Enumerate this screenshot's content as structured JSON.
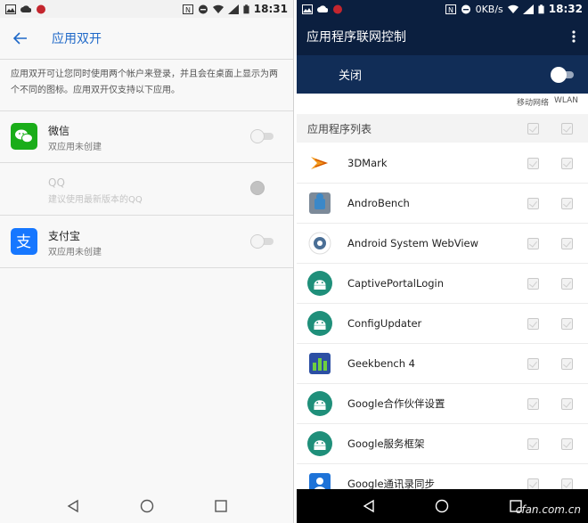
{
  "left": {
    "statusbar": {
      "time": "18:31"
    },
    "header": {
      "title": "应用双开"
    },
    "description": "应用双开可让您同时使用两个帐户来登录，并且会在桌面上显示为两个不同的图标。应用双开仅支持以下应用。",
    "apps": [
      {
        "name": "微信",
        "subtitle": "双应用未创建",
        "enabled": true,
        "icon": "wechat-icon",
        "color": "#1aad19"
      },
      {
        "name": "QQ",
        "subtitle": "建议使用最新版本的QQ",
        "enabled": false,
        "icon": "qq-icon"
      },
      {
        "name": "支付宝",
        "subtitle": "双应用未创建",
        "enabled": true,
        "icon": "alipay-icon",
        "color": "#1677ff"
      }
    ]
  },
  "right": {
    "statusbar": {
      "speed": "0KB/s",
      "time": "18:32"
    },
    "header": {
      "title": "应用程序联网控制"
    },
    "master": {
      "label": "关闭"
    },
    "columns": {
      "mobile": "移动网络",
      "wlan": "WLAN"
    },
    "list_header": "应用程序列表",
    "apps": [
      {
        "name": "3DMark",
        "icon": "3dmark-icon"
      },
      {
        "name": "AndroBench",
        "icon": "androbench-icon"
      },
      {
        "name": "Android System WebView",
        "icon": "webview-gear-icon"
      },
      {
        "name": "CaptivePortalLogin",
        "icon": "android-icon"
      },
      {
        "name": "ConfigUpdater",
        "icon": "android-icon"
      },
      {
        "name": "Geekbench 4",
        "icon": "geekbench-icon"
      },
      {
        "name": "Google合作伙伴设置",
        "icon": "android-icon"
      },
      {
        "name": "Google服务框架",
        "icon": "android-icon"
      },
      {
        "name": "Google通讯录同步",
        "icon": "contacts-icon"
      }
    ],
    "watermark": "cfan.com.cn"
  },
  "colors": {
    "accent": "#1e68c8",
    "dark_header": "#0b1f3f",
    "close_bar": "#112d57"
  }
}
